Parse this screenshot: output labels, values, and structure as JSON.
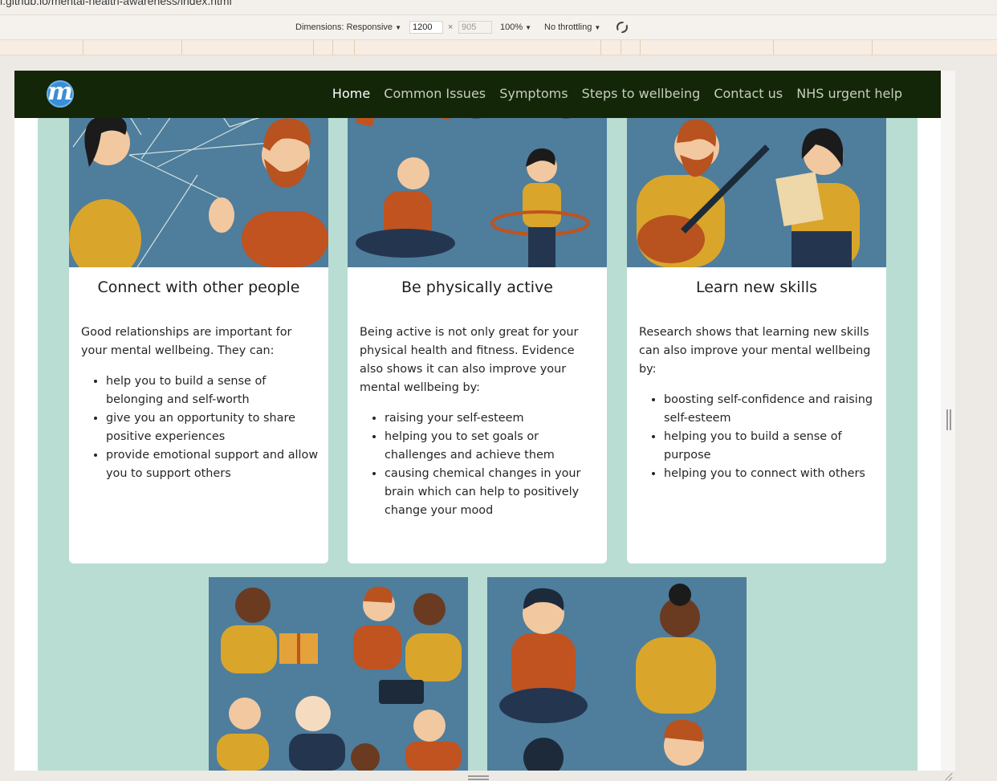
{
  "browser": {
    "url": "i.github.io/mental-health-awareness/index.html"
  },
  "device_toolbar": {
    "dimensions_label": "Dimensions: Responsive",
    "width": "1200",
    "height": "905",
    "times": "×",
    "zoom": "100%",
    "throttling": "No throttling"
  },
  "nav": {
    "logo_letter": "m",
    "items": [
      {
        "label": "Home",
        "active": true
      },
      {
        "label": "Common Issues",
        "active": false
      },
      {
        "label": "Symptoms",
        "active": false
      },
      {
        "label": "Steps to wellbeing",
        "active": false
      },
      {
        "label": "Contact us",
        "active": false
      },
      {
        "label": "NHS urgent help",
        "active": false
      }
    ]
  },
  "cards": [
    {
      "title": "Connect with other people",
      "intro": "Good relationships are important for your mental wellbeing. They can:",
      "bullets": [
        "help you to build a sense of belonging and self-worth",
        "give you an opportunity to share positive experiences",
        "provide emotional support and allow you to support others"
      ]
    },
    {
      "title": "Be physically active",
      "intro": "Being active is not only great for your physical health and fitness. Evidence also shows it can also improve your mental wellbeing by:",
      "bullets": [
        "raising your self-esteem",
        "helping you to set goals or challenges and achieve them",
        "causing chemical changes in your brain which can help to positively change your mood"
      ]
    },
    {
      "title": "Learn new skills",
      "intro": "Research shows that learning new skills can also improve your mental wellbeing by:",
      "bullets": [
        "boosting self-confidence and raising self-esteem",
        "helping you to build a sense of purpose",
        "helping you to connect with others"
      ]
    }
  ],
  "colors": {
    "nav_bg": "#132608",
    "page_bg": "#b9ddd3",
    "illustration_bg": "#4f7d9c",
    "mustard": "#d9a62b",
    "rust": "#c0531f"
  }
}
